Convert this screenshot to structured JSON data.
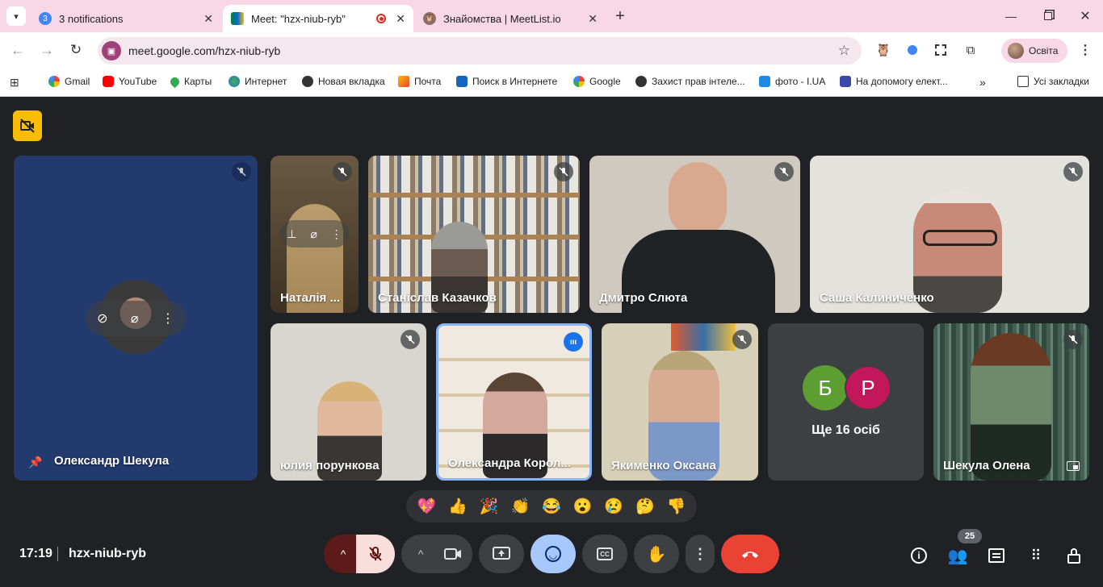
{
  "browser": {
    "tabs": [
      {
        "label": "3 notifications",
        "badge": "3"
      },
      {
        "label": "Meet: \"hzx-niub-ryb\""
      },
      {
        "label": "Знайомства | MeetList.io"
      }
    ],
    "url": "meet.google.com/hzx-niub-ryb",
    "profile": "Освіта",
    "bookmarks": [
      "Gmail",
      "YouTube",
      "Карты",
      "Интернет",
      "Новая вкладка",
      "Почта",
      "Поиск в Интернете",
      "Google",
      "Захист прав інтеле...",
      "фото - I.UA",
      "На допомогу елект..."
    ],
    "all_bookmarks": "Усі закладки"
  },
  "meet": {
    "participants": [
      {
        "name": "Олександр Шекула"
      },
      {
        "name": "Наталія ..."
      },
      {
        "name": "Станіслав Казачков"
      },
      {
        "name": "Дмитро Слюта"
      },
      {
        "name": "Саша Калиниченко"
      },
      {
        "name": "юлия порункова"
      },
      {
        "name": "Олександра Корол..."
      },
      {
        "name": "Якименко Оксана"
      },
      {
        "name": "Шекула Олена"
      }
    ],
    "others": {
      "initials": [
        "Б",
        "Р"
      ],
      "label": "Ще 16 осіб"
    },
    "reactions": [
      "💖",
      "👍",
      "🎉",
      "👏",
      "😂",
      "😮",
      "😢",
      "🤔",
      "👎"
    ],
    "time": "17:19",
    "code": "hzx-niub-ryb",
    "people_count": "25",
    "colors": {
      "end_call": "#ea4335",
      "mic_off": "#f9dedc",
      "active_button": "#a8c7fa",
      "speaking_border": "#8ab4f8"
    }
  }
}
